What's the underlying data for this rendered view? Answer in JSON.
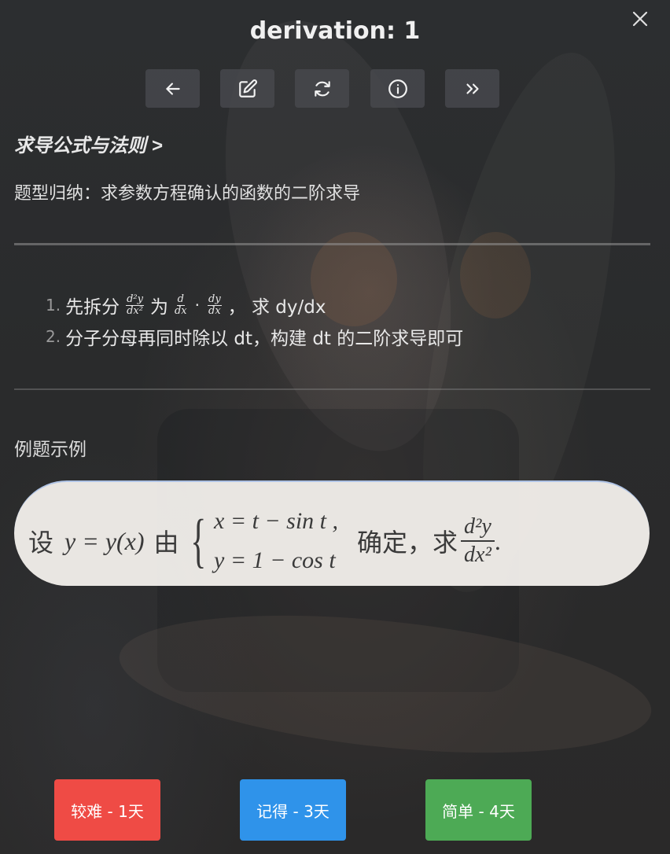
{
  "header": {
    "title": "derivation: 1",
    "close_icon": "close-icon"
  },
  "toolbar": {
    "buttons": [
      {
        "icon": "arrow-left-icon"
      },
      {
        "icon": "edit-icon"
      },
      {
        "icon": "refresh-icon"
      },
      {
        "icon": "info-icon"
      },
      {
        "icon": "double-chevron-right-icon"
      }
    ]
  },
  "card": {
    "breadcrumb": "求导公式与法则 >",
    "subtitle": "题型归纳：求参数方程确认的函数的二阶求导",
    "steps": [
      {
        "num": "1.",
        "pre": "先拆分",
        "frac1_num": "d²y",
        "frac1_den": "dx²",
        "mid": "为",
        "frac2_num": "d",
        "frac2_den": "dx",
        "dot": "·",
        "frac3_num": "dy",
        "frac3_den": "dx",
        "post": "， 求 dy/dx"
      },
      {
        "num": "2.",
        "text": "分子分母再同时除以 dt，构建 dt 的二阶求导即可"
      }
    ],
    "example_label": "例题示例",
    "example": {
      "prefix": "设",
      "func": "y = y(x)",
      "by": "由",
      "brace": "{",
      "line1": "x = t − sin t ,",
      "line2": "y = 1 − cos t",
      "suffix": "确定，求",
      "deriv_num": "d²y",
      "deriv_den": "dx²",
      "period": "."
    }
  },
  "review": {
    "hard_label": "较难 - 1天",
    "good_label": "记得 - 3天",
    "easy_label": "简单 - 4天"
  },
  "colors": {
    "hard": "#ef4b45",
    "good": "#2f93ea",
    "easy": "#4daa55",
    "background": "#2a2b2c"
  }
}
